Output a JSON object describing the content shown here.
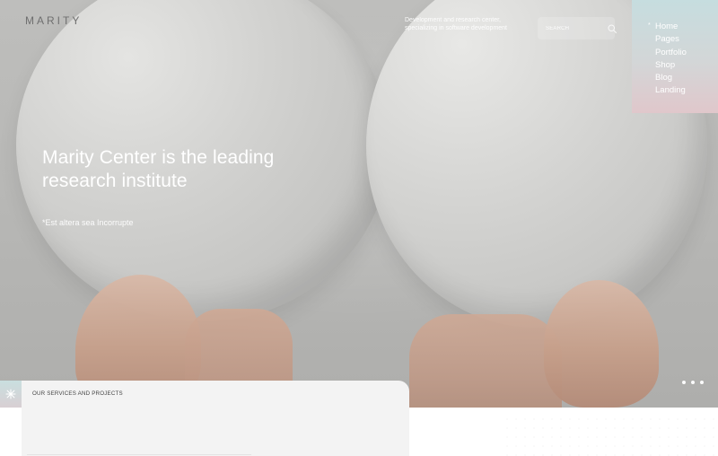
{
  "header": {
    "logo_text": "MARITY",
    "tagline": "Development and research center, specializing in software development"
  },
  "search": {
    "placeholder": "SEARCH",
    "icon": "search-icon"
  },
  "nav": {
    "items": [
      {
        "label": "Home",
        "active": true
      },
      {
        "label": "Pages",
        "active": false
      },
      {
        "label": "Portfolio",
        "active": false
      },
      {
        "label": "Shop",
        "active": false
      },
      {
        "label": "Blog",
        "active": false
      },
      {
        "label": "Landing",
        "active": false
      }
    ],
    "active_marker": "*"
  },
  "hero": {
    "headline": "Marity Center is the leading research institute",
    "subline": "*Est altera sea Incorrupte",
    "pagination_dots_count": 3
  },
  "services": {
    "label": "OUR SERVICES AND PROJECTS",
    "accent_icon": "asterisk-icon"
  },
  "colors": {
    "text_white": "#ffffff",
    "logo_gray": "#6f6f6f",
    "nav_gradient_top": "#c6dddf",
    "nav_gradient_bottom": "#e0c7cb",
    "services_card_bg": "#f3f3f3"
  }
}
